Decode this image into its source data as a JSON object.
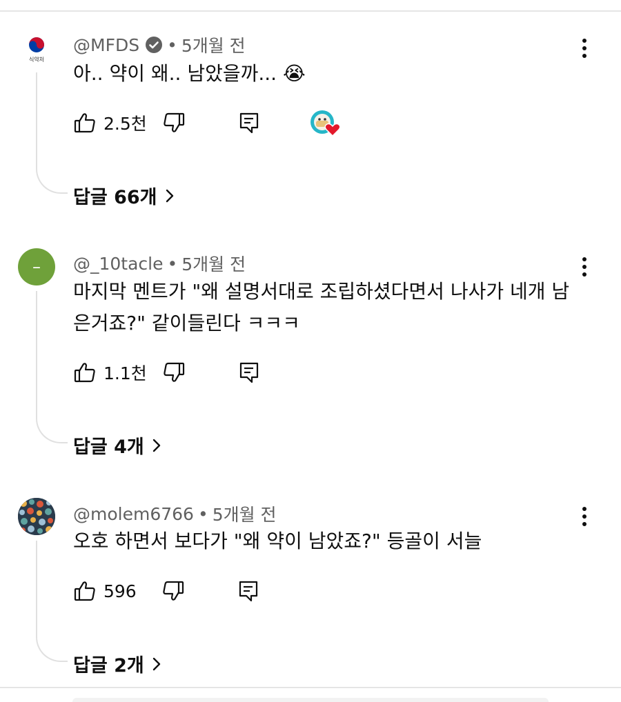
{
  "comments": [
    {
      "handle": "@MFDS",
      "verified": true,
      "time": "5개월 전",
      "text": "아.. 약이 왜.. 남았을까... 😭",
      "likes": "2.5천",
      "creator_heart": true,
      "replies_label": "답글 66개",
      "avatar": {
        "type": "logo",
        "logo_text": "식약처",
        "colors": [
          "#c8102e",
          "#003da5"
        ]
      }
    },
    {
      "handle": "@_10tacle",
      "verified": false,
      "time": "5개월 전",
      "text": "마지막 멘트가 \"왜 설명서대로 조립하셨다면서 나사가 네개 남은거죠?\" 같이들린다 ㅋㅋㅋ",
      "likes": "1.1천",
      "creator_heart": false,
      "replies_label": "답글 4개",
      "avatar": {
        "type": "letter",
        "letter": "–",
        "color": "#6fa13a"
      }
    },
    {
      "handle": "@molem6766",
      "verified": false,
      "time": "5개월 전",
      "text": "오호 하면서 보다가 \"왜 약이 남았죠?\" 등골이 서늘",
      "likes": "596",
      "creator_heart": false,
      "replies_label": "답글 2개",
      "avatar": {
        "type": "pattern",
        "colors": [
          "#2a3b4c",
          "#e8b04a",
          "#5fa3a0",
          "#d9573b",
          "#9fc0d6"
        ]
      }
    }
  ],
  "icons": {
    "like": "thumbs-up-icon",
    "dislike": "thumbs-down-icon",
    "reply": "comment-reply-icon",
    "more": "more-vert-icon",
    "expand": "chevron-right-icon",
    "verified": "verified-check-icon",
    "heart": "creator-heart-icon"
  }
}
